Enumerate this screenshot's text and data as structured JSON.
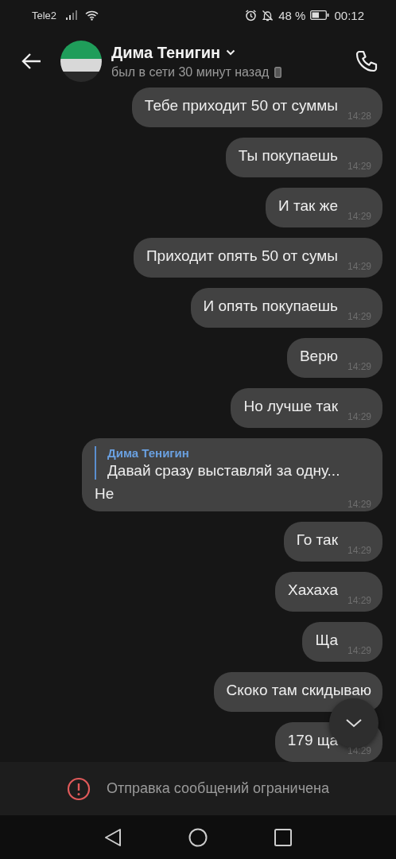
{
  "status_bar": {
    "carrier": "Tele2",
    "battery_percent": "48 %",
    "time": "00:12"
  },
  "header": {
    "name": "Дима Тенигин",
    "status": "был в сети 30 минут назад"
  },
  "messages": [
    {
      "text": "Тебе приходит 50 от суммы",
      "time": "14:28"
    },
    {
      "text": "Ты покупаешь",
      "time": "14:29"
    },
    {
      "text": "И так же",
      "time": "14:29"
    },
    {
      "text": "Приходит опять 50 от сумы",
      "time": "14:29"
    },
    {
      "text": "И опять покупаешь",
      "time": "14:29"
    },
    {
      "text": "Верю",
      "time": "14:29"
    },
    {
      "text": "Но лучше так",
      "time": "14:29"
    },
    {
      "text": "Не",
      "time": "14:29",
      "reply": {
        "author": "Дима Тенигин",
        "text": "Давай сразу выставляй за одну..."
      }
    },
    {
      "text": "Го так",
      "time": "14:29"
    },
    {
      "text": "Хахаха",
      "time": "14:29"
    },
    {
      "text": "Ща",
      "time": "14:29"
    },
    {
      "text": "Скоко там скидываю"
    },
    {
      "text": "179 ща",
      "time": "14:29"
    }
  ],
  "restriction_notice": "Отправка сообщений ограничена"
}
